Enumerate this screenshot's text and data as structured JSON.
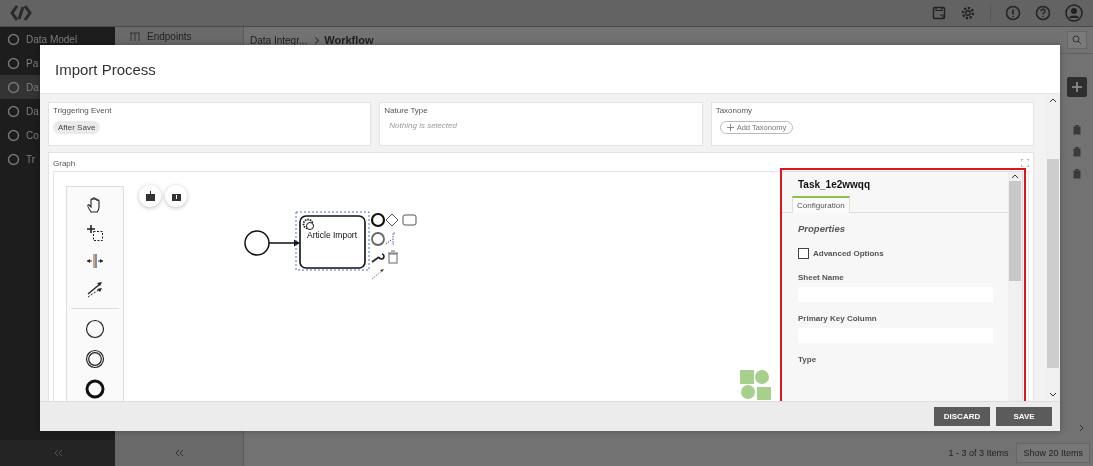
{
  "sidebar": {
    "items": [
      {
        "label": "Data Model",
        "selected": false
      },
      {
        "label": "Pa",
        "selected": false
      },
      {
        "label": "Da",
        "selected": true
      },
      {
        "label": "Da",
        "selected": false
      },
      {
        "label": "Co",
        "selected": false
      },
      {
        "label": "Tr",
        "selected": false
      }
    ]
  },
  "list_panel": {
    "title": "Endpoints"
  },
  "breadcrumb": [
    "Data Integr...",
    "Workflow"
  ],
  "pager": {
    "summary": "1 - 3 of 3 Items",
    "page_size": "Show 20 Items"
  },
  "modal": {
    "title": "Import Process",
    "fields": [
      {
        "kind": "chip",
        "label": "Triggering Event",
        "value": "After Save"
      },
      {
        "kind": "select",
        "label": "Nature Type",
        "placeholder": "Nothing is selected"
      },
      {
        "kind": "add",
        "label": "Taxonomy",
        "button": "Add Taxonomy"
      }
    ],
    "graph": {
      "label": "Graph",
      "task": "Article Import",
      "properties": {
        "title": "Task_1e2wwqq",
        "tabs": [
          {
            "label": "Configuration",
            "selected": true
          }
        ],
        "section": "Properties",
        "options": [
          {
            "kind": "checkbox",
            "label": "Advanced Options",
            "checked": false
          },
          {
            "kind": "text",
            "label": "Sheet Name"
          },
          {
            "kind": "text",
            "label": "Primary Key Column"
          },
          {
            "kind": "heading",
            "label": "Type"
          }
        ]
      }
    },
    "buttons": [
      "DISCARD",
      "SAVE"
    ]
  }
}
